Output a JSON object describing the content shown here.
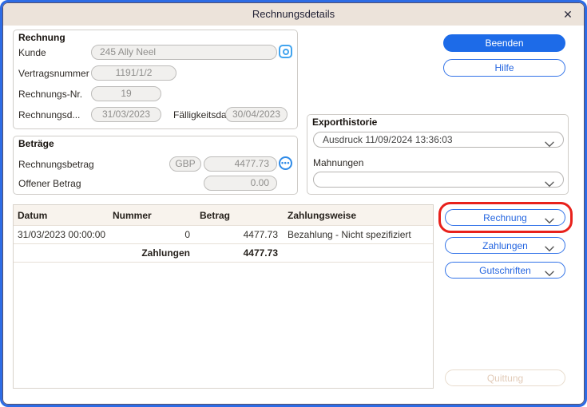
{
  "window": {
    "title": "Rechnungsdetails",
    "close_glyph": "✕"
  },
  "rechnung_section": {
    "title": "Rechnung",
    "kunde_label": "Kunde",
    "kunde_value": "245 Ally Neel",
    "vertragsnummer_label": "Vertragsnummer",
    "vertragsnummer_value": "1191/1/2",
    "rechnungsnr_label": "Rechnungs-Nr.",
    "rechnungsnr_value": "19",
    "rechnungsdatum_label": "Rechnungsd...",
    "rechnungsdatum_value": "31/03/2023",
    "faelligkeitsdatum_label": "Fälligkeitsda",
    "faelligkeitsdatum_value": "30/04/2023"
  },
  "betraege_section": {
    "title": "Beträge",
    "rechnungsbetrag_label": "Rechnungsbetrag",
    "currency_value": "GBP",
    "rechnungsbetrag_value": "4477.73",
    "ellipsis_glyph": "•••",
    "offener_betrag_label": "Offener Betrag",
    "offener_betrag_value": "0.00"
  },
  "export_section": {
    "title": "Exporthistorie",
    "export_value": "Ausdruck 11/09/2024 13:36:03",
    "mahnungen_label": "Mahnungen",
    "mahnungen_value": ""
  },
  "payments_table": {
    "headers": [
      "Datum",
      "Nummer",
      "Betrag",
      "Zahlungsweise"
    ],
    "rows": [
      [
        "31/03/2023 00:00:00",
        "0",
        "4477.73",
        "Bezahlung - Nicht spezifiziert"
      ]
    ],
    "summary_label": "Zahlungen",
    "summary_value": "4477.73"
  },
  "buttons": {
    "beenden": "Beenden",
    "hilfe": "Hilfe",
    "rechnung": "Rechnung",
    "zahlungen": "Zahlungen",
    "gutschriften": "Gutschriften",
    "quittung": "Quittung"
  },
  "colors": {
    "accent_blue": "#1d6be8",
    "titlebar_beige": "#ece3da",
    "annotation_red": "#e8211b",
    "window_border_blue": "#2d6ce5"
  }
}
